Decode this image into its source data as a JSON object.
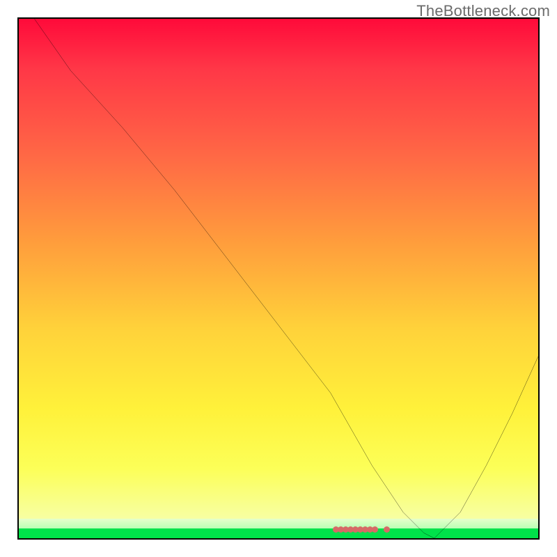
{
  "watermark": "TheBottleneck.com",
  "chart_data": {
    "type": "line",
    "title": "",
    "xlabel": "",
    "ylabel": "",
    "xlim": [
      0,
      100
    ],
    "ylim": [
      0,
      100
    ],
    "grid": false,
    "legend": false,
    "series": [
      {
        "name": "curve",
        "x": [
          3,
          10,
          20,
          30,
          40,
          50,
          60,
          68,
          74,
          78,
          80,
          85,
          90,
          95,
          100
        ],
        "y": [
          100,
          90,
          79,
          67,
          54,
          41,
          28,
          14,
          5,
          1,
          0,
          5,
          14,
          24,
          35
        ]
      }
    ],
    "markers": {
      "name": "highlight-range",
      "x": [
        62,
        63,
        64,
        65,
        66,
        67,
        68,
        69,
        70,
        74
      ],
      "y": [
        1,
        1,
        1,
        1,
        1,
        1,
        1,
        1,
        1,
        1
      ],
      "color": "#d66a66"
    },
    "background": {
      "type": "vertical-gradient",
      "stops": [
        {
          "pos": 0.0,
          "color": "#ff0a3a"
        },
        {
          "pos": 0.45,
          "color": "#ff9e3c"
        },
        {
          "pos": 0.8,
          "color": "#fff13a"
        },
        {
          "pos": 0.965,
          "color": "#f7ffa3"
        },
        {
          "pos": 0.98,
          "color": "#b9ffb4"
        },
        {
          "pos": 1.0,
          "color": "#00e24a"
        }
      ]
    }
  }
}
